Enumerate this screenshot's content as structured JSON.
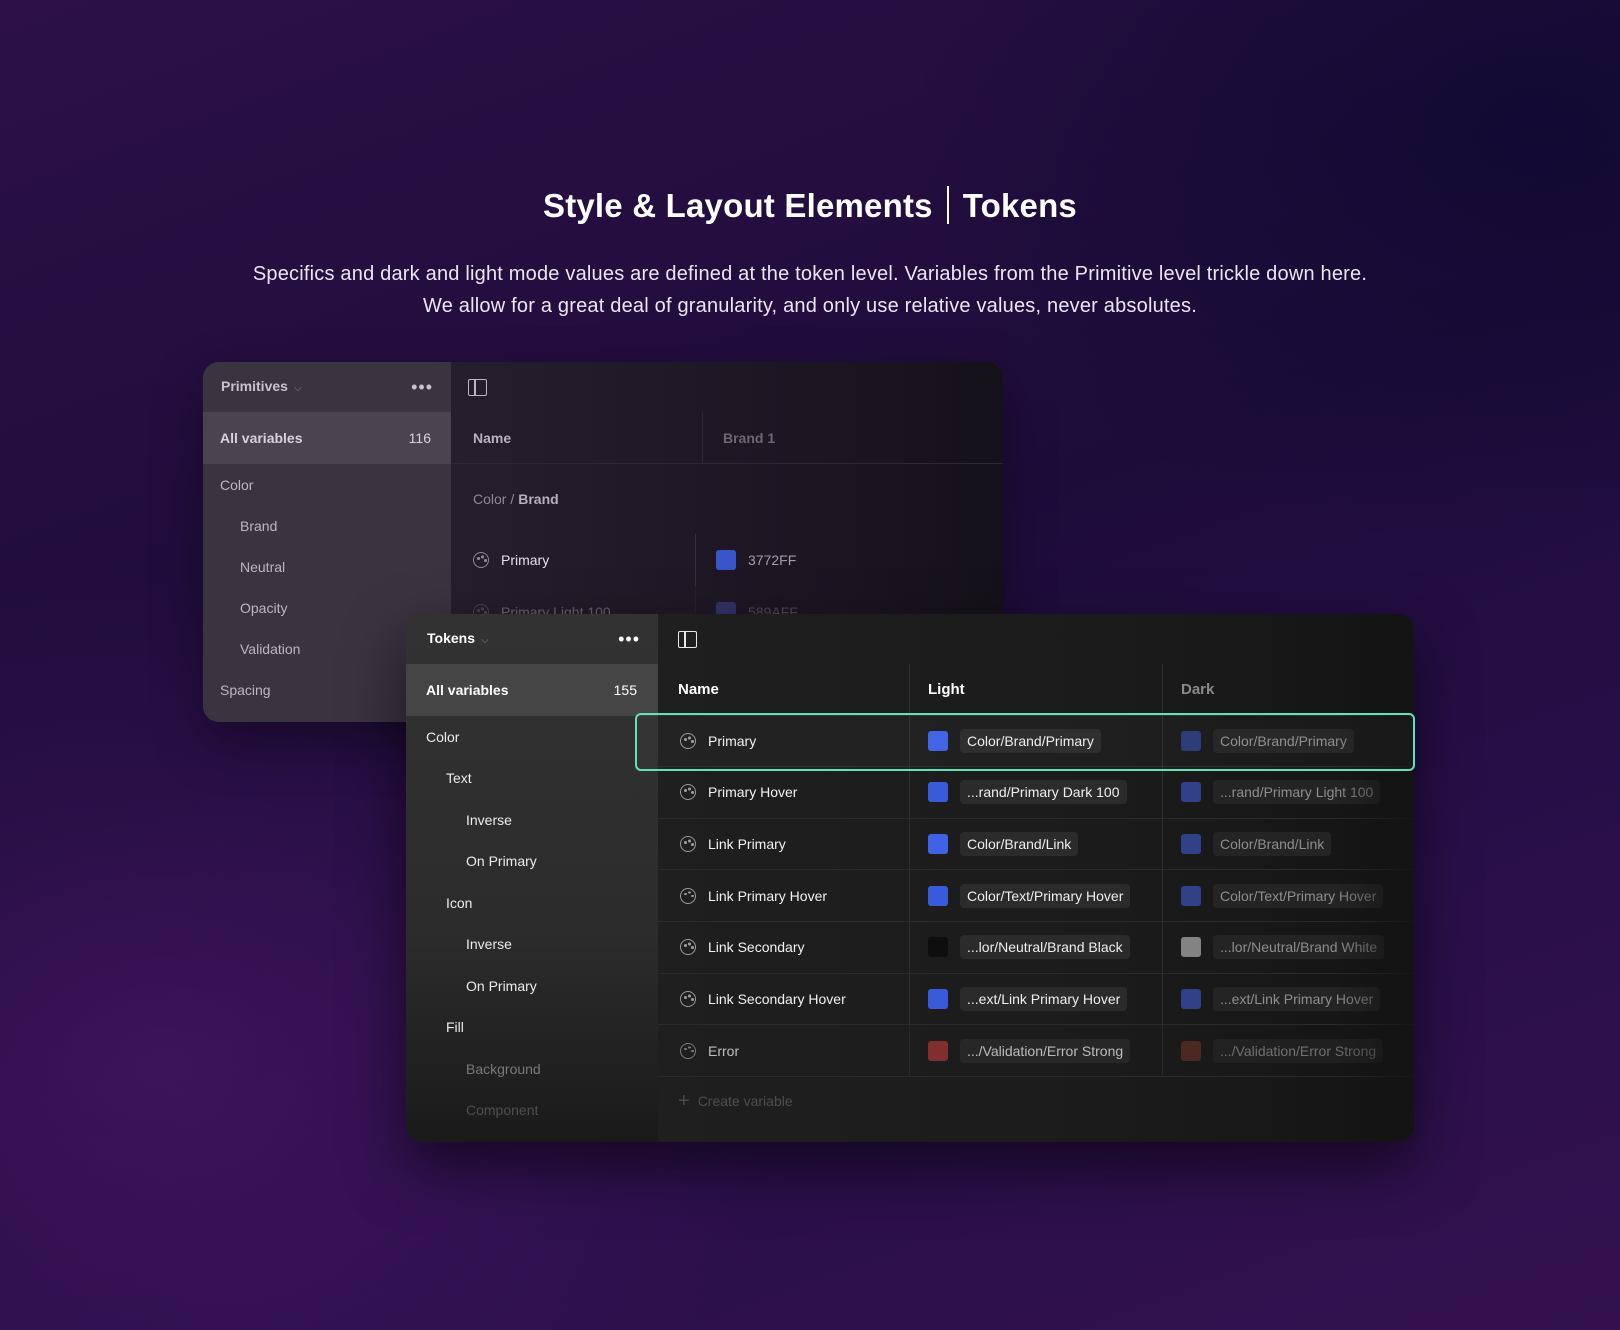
{
  "header": {
    "title_left": "Style & Layout Elements",
    "title_right": "Tokens",
    "subtitle": "Specifics and dark and light mode values are defined at the token level. Variables from the Primitive level trickle down here. We allow for a great deal of granularity, and only use relative values, never absolutes."
  },
  "primitives": {
    "collection": "Primitives",
    "all_label": "All variables",
    "all_count": "116",
    "groups": [
      {
        "label": "Color",
        "level": 1
      },
      {
        "label": "Brand",
        "level": 2
      },
      {
        "label": "Neutral",
        "level": 2
      },
      {
        "label": "Opacity",
        "level": 2
      },
      {
        "label": "Validation",
        "level": 2
      },
      {
        "label": "Spacing",
        "level": 1
      }
    ],
    "col_name": "Name",
    "col_mode": "Brand 1",
    "crumb_prefix": "Color /",
    "crumb_current": "Brand",
    "rows": [
      {
        "name": "Primary",
        "value": "3772FF",
        "swatch": "#3a55c9"
      },
      {
        "name": "Primary Light 100",
        "value": "589AFF",
        "swatch": "#5a5fe0"
      }
    ]
  },
  "tokens": {
    "collection": "Tokens",
    "all_label": "All variables",
    "all_count": "155",
    "groups": [
      {
        "label": "Color",
        "level": 1
      },
      {
        "label": "Text",
        "level": 2
      },
      {
        "label": "Inverse",
        "level": 3
      },
      {
        "label": "On Primary",
        "level": 3
      },
      {
        "label": "Icon",
        "level": 2
      },
      {
        "label": "Inverse",
        "level": 3
      },
      {
        "label": "On Primary",
        "level": 3
      },
      {
        "label": "Fill",
        "level": 2
      },
      {
        "label": "Background",
        "level": 3
      },
      {
        "label": "Component",
        "level": 3
      }
    ],
    "col_name": "Name",
    "col_light": "Light",
    "col_dark": "Dark",
    "rows": [
      {
        "name": "Primary",
        "light": "Color/Brand/Primary",
        "light_swatch": "#3f62e6",
        "dark": "Color/Brand/Primary",
        "dark_swatch": "#3550b8"
      },
      {
        "name": "Primary Hover",
        "light": "...rand/Primary Dark 100",
        "light_swatch": "#3b5ad9",
        "dark": "...rand/Primary Light 100",
        "dark_swatch": "#3f5bd4"
      },
      {
        "name": "Link Primary",
        "light": "Color/Brand/Link",
        "light_swatch": "#3f62e6",
        "dark": "Color/Brand/Link",
        "dark_swatch": "#3f5bd4"
      },
      {
        "name": "Link Primary Hover",
        "light": "Color/Text/Primary Hover",
        "light_swatch": "#3b5ad9",
        "dark": "Color/Text/Primary Hover",
        "dark_swatch": "#3f5bd4"
      },
      {
        "name": "Link Secondary",
        "light": "...lor/Neutral/Brand Black",
        "light_swatch": "#0e0e0e",
        "dark": "...lor/Neutral/Brand White",
        "dark_swatch": "#c9c9c9"
      },
      {
        "name": "Link Secondary Hover",
        "light": "...ext/Link Primary Hover",
        "light_swatch": "#3b5ad9",
        "dark": "...ext/Link Primary Hover",
        "dark_swatch": "#3f5bd4"
      },
      {
        "name": "Error",
        "light": ".../Validation/Error Strong",
        "light_swatch": "#a33535",
        "dark": ".../Validation/Error Strong",
        "dark_swatch": "#8a3a2f"
      }
    ],
    "create_label": "Create variable"
  },
  "colors": {
    "highlight": "#5fe3b5"
  }
}
